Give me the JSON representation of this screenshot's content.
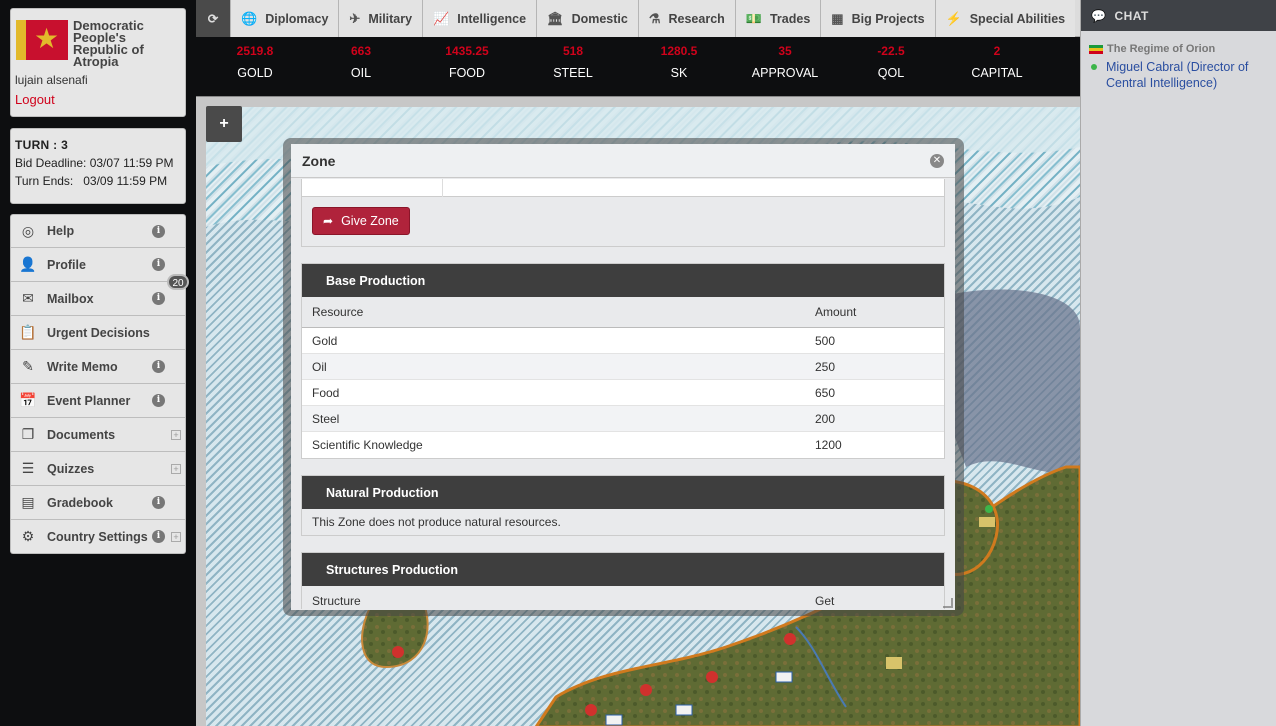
{
  "country": {
    "name": "Democratic People's Republic of Atropia",
    "user": "lujain alsenafi",
    "logout_label": "Logout"
  },
  "turn": {
    "label": "TURN : 3",
    "bid_deadline": "Bid Deadline: 03/07 11:59 PM",
    "turn_ends": "Turn Ends:   03/09 11:59 PM"
  },
  "menu": [
    {
      "label": "Help",
      "icon": "lifebuoy-icon"
    },
    {
      "label": "Profile",
      "icon": "user-icon"
    },
    {
      "label": "Mailbox",
      "icon": "envelope-icon",
      "badge": "20"
    },
    {
      "label": "Urgent Decisions",
      "icon": "clipboard-icon"
    },
    {
      "label": "Write Memo",
      "icon": "edit-icon"
    },
    {
      "label": "Event Planner",
      "icon": "calendar-icon"
    },
    {
      "label": "Documents",
      "icon": "documents-icon"
    },
    {
      "label": "Quizzes",
      "icon": "list-icon"
    },
    {
      "label": "Gradebook",
      "icon": "book-icon"
    },
    {
      "label": "Country Settings",
      "icon": "gear-icon"
    }
  ],
  "tabs": [
    {
      "label": "Diplomacy",
      "icon": "globe-icon"
    },
    {
      "label": "Military",
      "icon": "plane-icon"
    },
    {
      "label": "Intelligence",
      "icon": "chart-line-icon"
    },
    {
      "label": "Domestic",
      "icon": "building-icon"
    },
    {
      "label": "Research",
      "icon": "flask-icon"
    },
    {
      "label": "Trades",
      "icon": "money-icon"
    },
    {
      "label": "Big Projects",
      "icon": "grid-building-icon"
    },
    {
      "label": "Special Abilities",
      "icon": "bolt-icon"
    }
  ],
  "stats": [
    {
      "value": "2519.8",
      "label": "GOLD"
    },
    {
      "value": "663",
      "label": "OIL"
    },
    {
      "value": "1435.25",
      "label": "FOOD"
    },
    {
      "value": "518",
      "label": "STEEL"
    },
    {
      "value": "1280.5",
      "label": "SK"
    },
    {
      "value": "35",
      "label": "APPROVAL"
    },
    {
      "value": "-22.5",
      "label": "QOL"
    },
    {
      "value": "2",
      "label": "CAPITAL"
    }
  ],
  "chat": {
    "title": "CHAT",
    "group": "The Regime of Orion",
    "member": "Miguel Cabral (Director of Central Intelligence)"
  },
  "map": {
    "zoom_label": "+"
  },
  "modal": {
    "title": "Zone",
    "give_zone_label": "Give Zone",
    "base_production": {
      "title": "Base Production",
      "headers": [
        "Resource",
        "Amount"
      ],
      "rows": [
        {
          "resource": "Gold",
          "amount": "500"
        },
        {
          "resource": "Oil",
          "amount": "250"
        },
        {
          "resource": "Food",
          "amount": "650"
        },
        {
          "resource": "Steel",
          "amount": "200"
        },
        {
          "resource": "Scientific Knowledge",
          "amount": "1200"
        }
      ]
    },
    "natural_production": {
      "title": "Natural Production",
      "text": "This Zone does not produce natural resources."
    },
    "structures_production": {
      "title": "Structures Production",
      "headers": [
        "Structure",
        "Get"
      ]
    }
  }
}
